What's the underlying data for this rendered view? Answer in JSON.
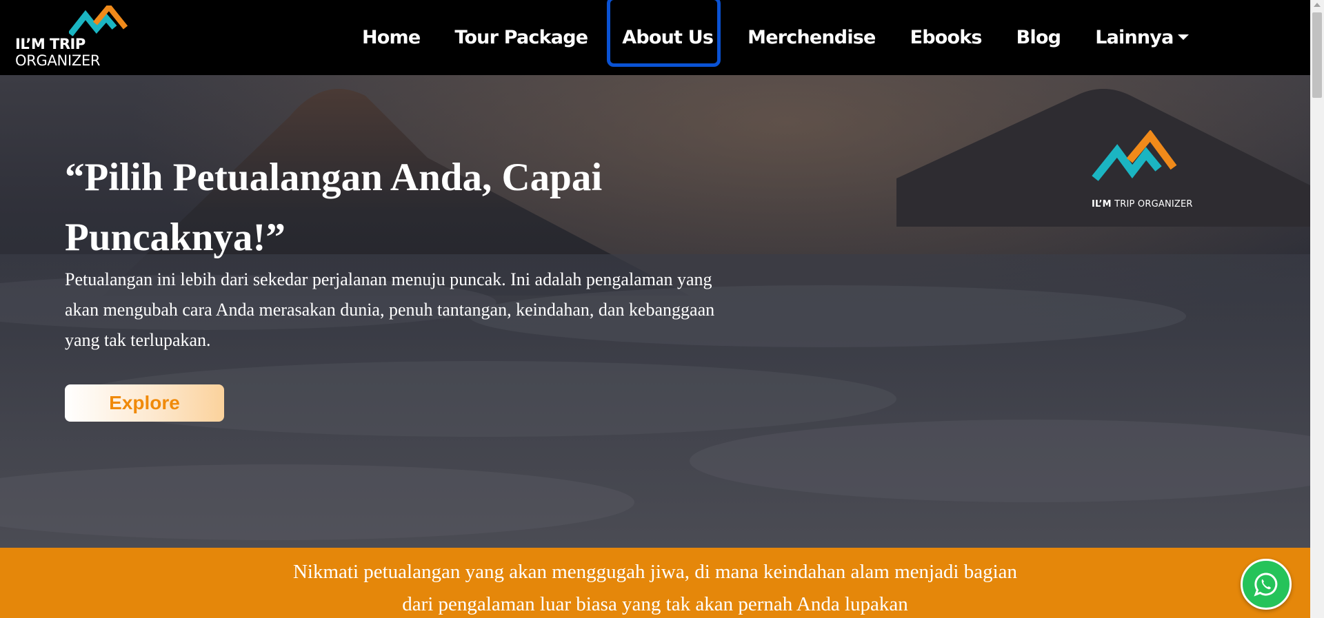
{
  "brand": {
    "logo_line1": "IL’M TRIP",
    "logo_line2": "ORGANIZER",
    "colors": {
      "teal": "#1bb5c2",
      "orange": "#f08a1a",
      "accent_orange": "#e5870a",
      "highlight_blue": "#0a52d4"
    }
  },
  "nav": {
    "items": [
      {
        "label": "Home"
      },
      {
        "label": "Tour Package"
      },
      {
        "label": "About Us"
      },
      {
        "label": "Merchendise"
      },
      {
        "label": "Ebooks"
      },
      {
        "label": "Blog"
      },
      {
        "label": "Lainnya"
      }
    ]
  },
  "hero": {
    "title": "“Pilih Petualangan Anda, Capai Puncaknya!”",
    "text": "Petualangan ini lebih dari sekedar perjalanan menuju puncak. Ini adalah pengalaman yang akan mengubah cara Anda merasakan dunia, penuh tantangan, keindahan, dan kebanggaan yang tak terlupakan.",
    "button_label": "Explore",
    "logo_caption_bold": "IL’M",
    "logo_caption_rest": " TRIP ORGANIZER"
  },
  "band": {
    "text": "Nikmati petualangan yang akan menggugah jiwa, di mana keindahan alam menjadi bagian dari pengalaman luar biasa yang tak akan pernah Anda lupakan"
  },
  "icons": {
    "whatsapp": "whatsapp-icon",
    "dropdown": "caret-down-icon"
  }
}
